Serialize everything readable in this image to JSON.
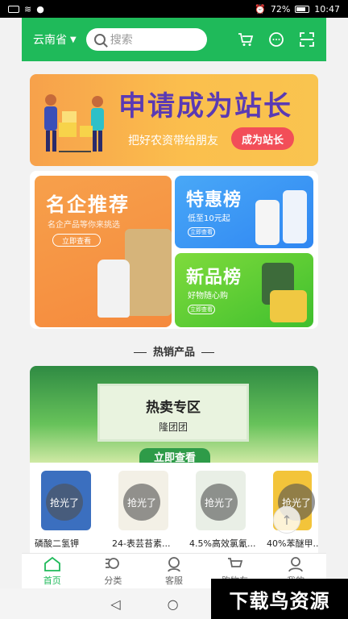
{
  "status_bar": {
    "battery": "72%",
    "time": "10:47"
  },
  "header": {
    "region": "云南省",
    "search_placeholder": "搜索",
    "icons": [
      "cart-icon",
      "chat-icon",
      "scan-icon"
    ]
  },
  "banner": {
    "title": "申请成为站长",
    "subtitle": "把好农资带给朋友",
    "cta": "成为站长"
  },
  "promo": {
    "mingqi": {
      "title": "名企推荐",
      "subtitle": "名企产品等你来挑选",
      "button": "立即查看"
    },
    "tehui": {
      "title": "特惠榜",
      "subtitle": "低至10元起",
      "button": "立即查看"
    },
    "xinpin": {
      "title": "新品榜",
      "subtitle": "好物随心购",
      "button": "立即查看"
    }
  },
  "section_title": "热销产品",
  "hot_zone": {
    "title": "热卖专区",
    "subtitle": "隆团团",
    "button": "立即查看"
  },
  "products": [
    {
      "name": "磷酸二氢钾",
      "badge": "抢光了"
    },
    {
      "name": "24-表芸苔素...",
      "badge": "抢光了"
    },
    {
      "name": "4.5%高效氯氰...",
      "badge": "抢光了"
    },
    {
      "name": "40%苯醚甲...",
      "badge": "抢光了"
    }
  ],
  "tabs": [
    {
      "label": "首页",
      "active": true
    },
    {
      "label": "分类",
      "active": false
    },
    {
      "label": "客服",
      "active": false
    },
    {
      "label": "购物车",
      "active": false
    },
    {
      "label": "我的",
      "active": false
    }
  ],
  "watermark": "下载鸟资源",
  "colors": {
    "brand_green": "#1fba5a",
    "banner_orange": "#f7a14b",
    "cta_red": "#f24e58"
  }
}
